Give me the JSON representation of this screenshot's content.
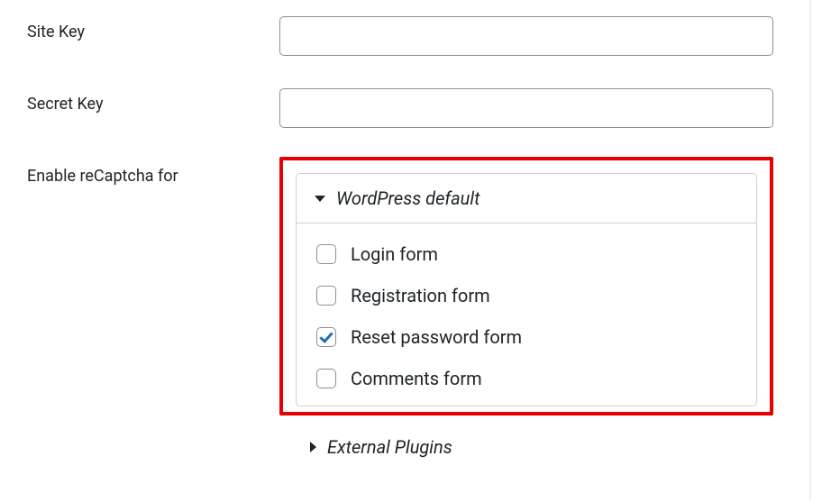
{
  "fields": {
    "site_key": {
      "label": "Site Key",
      "value": ""
    },
    "secret_key": {
      "label": "Secret Key",
      "value": ""
    },
    "enable_for": {
      "label": "Enable reCaptcha for"
    }
  },
  "sections": {
    "wp_default": {
      "title": "WordPress default",
      "expanded": true,
      "items": [
        {
          "label": "Login form",
          "checked": false
        },
        {
          "label": "Registration form",
          "checked": false
        },
        {
          "label": "Reset password form",
          "checked": true
        },
        {
          "label": "Comments form",
          "checked": false
        }
      ]
    },
    "external_plugins": {
      "title": "External Plugins",
      "expanded": false
    }
  }
}
